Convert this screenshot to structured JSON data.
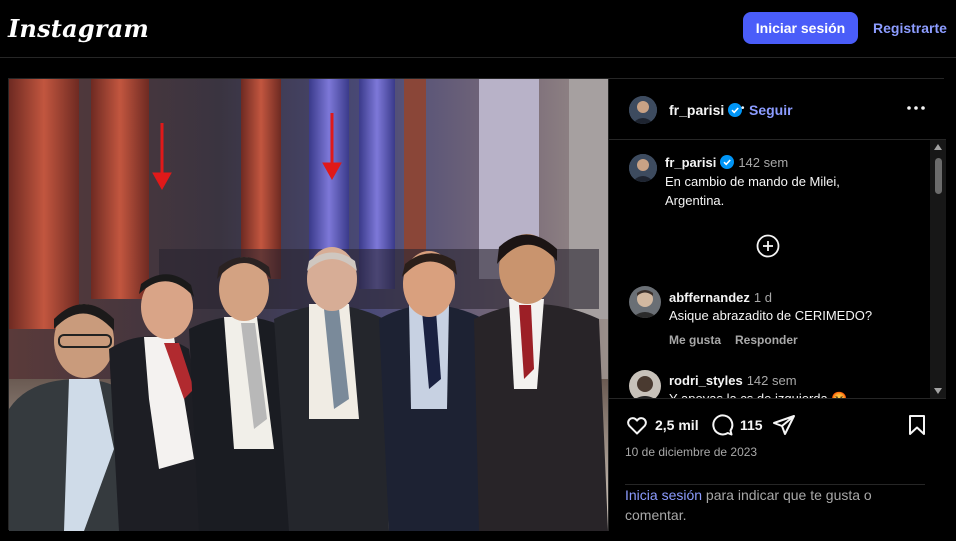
{
  "header": {
    "logo_text": "Instagram",
    "login_label": "Iniciar sesión",
    "signup_label": "Registrarte"
  },
  "post": {
    "author": {
      "username": "fr_parisi",
      "verified": true,
      "follow_label": "Seguir",
      "separator": "•"
    },
    "caption": {
      "username": "fr_parisi",
      "time": "142 sem",
      "text_line1": "En cambio de mando de Milei,",
      "text_line2": "Argentina."
    },
    "comments": [
      {
        "username": "abffernandez",
        "time": "1 d",
        "text": "Asique abrazadito de CERIMEDO?",
        "like_label": "Me gusta",
        "reply_label": "Responder"
      },
      {
        "username": "rodri_styles",
        "time": "142 sem",
        "text": "Y apoyas la cs de izquierda 🤬"
      }
    ],
    "likes": "2,5 mil",
    "comment_count": "115",
    "date": "10 de diciembre de 2023",
    "login_prompt_link": "Inicia sesión",
    "login_prompt_text": " para indicar que te gusta o comentar."
  },
  "colors": {
    "accent": "#4a5df9",
    "link": "#8c9cff",
    "verified": "#0095f6",
    "background": "#000000",
    "border": "#262626",
    "muted": "#a8a8a8"
  },
  "icons": [
    "verified-badge-icon",
    "more-options-icon",
    "add-comment-icon",
    "heart-icon",
    "comment-icon",
    "share-icon",
    "bookmark-icon"
  ]
}
